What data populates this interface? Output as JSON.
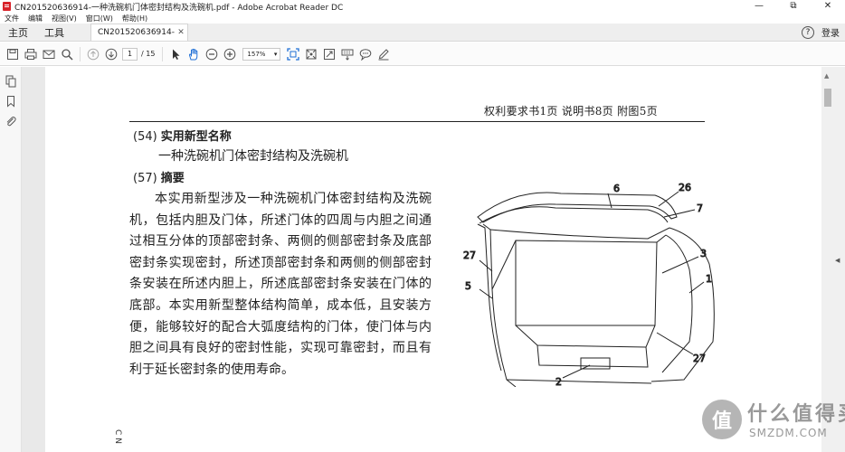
{
  "window": {
    "title": "CN201520636914-一种洗碗机门体密封结构及洗碗机.pdf - Adobe Acrobat Reader DC",
    "controls": [
      "—",
      "⧉",
      "✕"
    ]
  },
  "menu": [
    "文件",
    "编辑",
    "视图(V)",
    "窗口(W)",
    "帮助(H)"
  ],
  "tabs": {
    "home": "主页",
    "tools": "工具",
    "document": "CN201520636914-...",
    "close": "✕",
    "help": "?",
    "signin": "登录"
  },
  "toolbar": {
    "page_current": "1",
    "page_total": "/ 15",
    "zoom": "157%"
  },
  "document": {
    "header_refs": "权利要求书1页    说明书8页    附图5页",
    "field54_code": "(54)",
    "field54_label": "实用新型名称",
    "title": "一种洗碗机门体密封结构及洗碗机",
    "field57_code": "(57)",
    "field57_label": "摘要",
    "abstract": "本实用新型涉及一种洗碗机门体密封结构及洗碗机，包括内胆及门体，所述门体的四周与内胆之间通过相互分体的顶部密封条、两侧的侧部密封条及底部密封条实现密封，所述顶部密封条和两侧的侧部密封条安装在所述内胆上，所述底部密封条安装在门体的底部。本实用新型整体结构简单，成本低，且安装方便，能够较好的配合大弧度结构的门体，使门体与内胆之间具有良好的密封性能，实现可靠密封，而且有利于延长密封条的使用寿命。",
    "margin_note": "C N",
    "figure_labels": [
      "6",
      "26",
      "7",
      "3",
      "1",
      "27",
      "5",
      "27",
      "2"
    ]
  },
  "watermark": {
    "logo": "值",
    "text_cn": "什么值得买",
    "text_en": "SMZDM.COM"
  },
  "icons": [
    "save-icon",
    "print-icon",
    "mail-icon",
    "search-icon",
    "prev-page-icon",
    "next-page-icon",
    "select-arrow-icon",
    "hand-icon",
    "zoom-out-icon",
    "zoom-in-icon",
    "fit-page-icon",
    "crop-icon",
    "fullscreen-icon",
    "keyboard-icon",
    "comment-icon",
    "pen-icon",
    "pages-icon",
    "bookmark-icon",
    "attachment-icon"
  ]
}
